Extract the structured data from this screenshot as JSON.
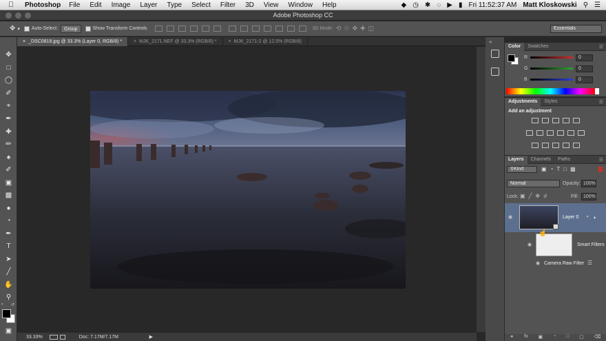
{
  "menubar": {
    "app": "Photoshop",
    "items": [
      "File",
      "Edit",
      "Image",
      "Layer",
      "Type",
      "Select",
      "Filter",
      "3D",
      "View",
      "Window",
      "Help"
    ],
    "clock": "Fri 11:52:37 AM",
    "user": "Matt Kloskowski"
  },
  "window": {
    "title": "Adobe Photoshop CC"
  },
  "options": {
    "auto_select": "Auto-Select:",
    "group": "Group",
    "show_transform": "Show Transform Controls",
    "mode3d": "3D Mode:",
    "workspace": "Essentials"
  },
  "tabs": [
    {
      "label": "_DSC0818.jpg @ 33.3% (Layer 0, RGB/8) *"
    },
    {
      "label": "MJK_2171.NEF @ 33.3% (RGB/8) *"
    },
    {
      "label": "MJK_2171-2 @ 12.5% (RGB/8)"
    }
  ],
  "status": {
    "zoom": "33.33%",
    "doc": "Doc: 7.17M/7.17M"
  },
  "color_panel": {
    "tabs": [
      "Color",
      "Swatches"
    ],
    "r_label": "R",
    "g_label": "G",
    "b_label": "B",
    "r": "0",
    "g": "0",
    "b": "0"
  },
  "adjustments": {
    "tabs": [
      "Adjustments",
      "Styles"
    ],
    "hint": "Add an adjustment"
  },
  "layers": {
    "tabs": [
      "Layers",
      "Channels",
      "Paths"
    ],
    "kind": "Kind",
    "blend": "Normal",
    "opacity_label": "Opacity:",
    "opacity": "100%",
    "lock_label": "Lock:",
    "fill_label": "Fill:",
    "fill": "100%",
    "layer_name": "Layer 0",
    "smart_filters": "Smart Filters",
    "filter_name": "Camera Raw Filter"
  },
  "colors": {
    "menubar_bg": "#e6e6e6",
    "chrome": "#535353",
    "dark": "#282828",
    "slider_r": "#d22b2b",
    "slider_g": "#2fa42f",
    "slider_b": "#2b3fd2"
  }
}
